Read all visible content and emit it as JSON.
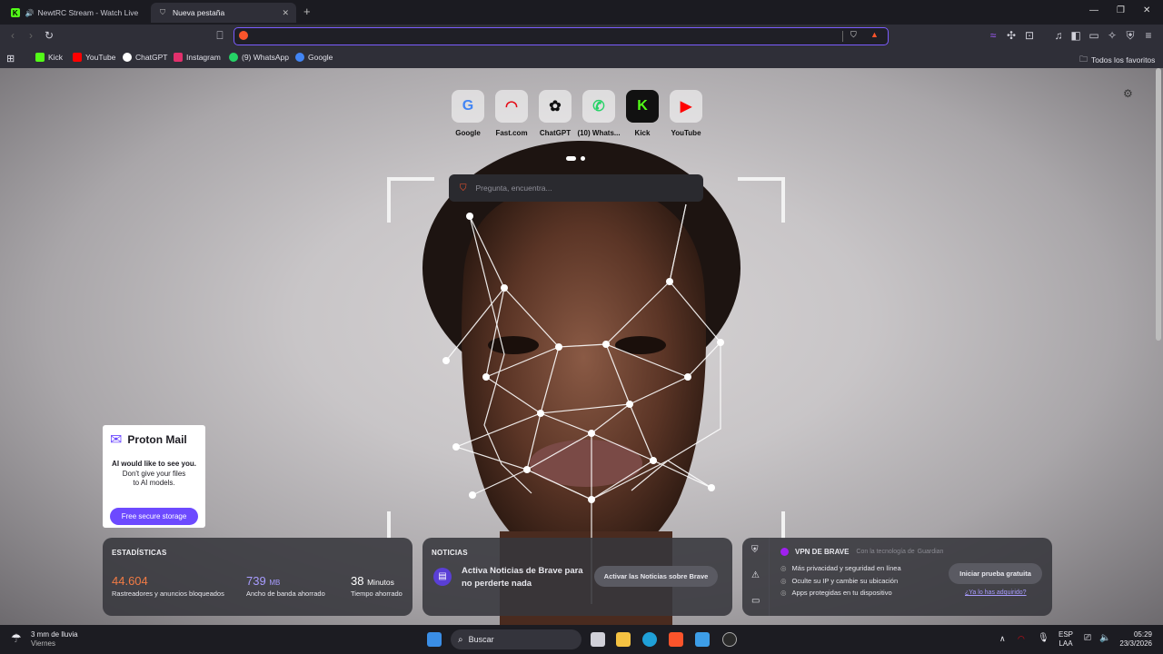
{
  "tabs": [
    {
      "title": "NewtRC Stream - Watch Live on K",
      "active": false
    },
    {
      "title": "Nueva pestaña",
      "active": true
    }
  ],
  "new_tab_symbol": "+",
  "window_controls": {
    "minimize": "—",
    "restore": "❐",
    "close": "✕"
  },
  "bookmarks": [
    {
      "label": "Kick",
      "icon": "kick-icon",
      "color": "#53fc18"
    },
    {
      "label": "YouTube",
      "icon": "youtube-icon",
      "color": "#ff0000"
    },
    {
      "label": "ChatGPT",
      "icon": "chatgpt-icon",
      "color": "#ffffff"
    },
    {
      "label": "Instagram",
      "icon": "instagram-icon",
      "color": "#e1306c"
    },
    {
      "label": "(9) WhatsApp",
      "icon": "whatsapp-icon",
      "color": "#25d366"
    },
    {
      "label": "Google",
      "icon": "google-icon",
      "color": "#4285f4"
    }
  ],
  "bookmarks_all": "Todos los favoritos",
  "shortcuts": [
    {
      "label": "Google",
      "glyph": "G",
      "color": "#4285f4"
    },
    {
      "label": "Fast.com",
      "glyph": "◠",
      "color": "#e50914"
    },
    {
      "label": "ChatGPT",
      "glyph": "✿",
      "color": "#111111"
    },
    {
      "label": "(10) Whats...",
      "glyph": "✆",
      "color": "#25d366"
    },
    {
      "label": "Kick",
      "glyph": "K",
      "color": "#53fc18"
    },
    {
      "label": "YouTube",
      "glyph": "▶",
      "color": "#ff0000"
    }
  ],
  "search": {
    "placeholder": "Pregunta, encuentra..."
  },
  "proton": {
    "brand": "Proton Mail",
    "line1": "AI would like to see you.",
    "line2": "Don't give your files",
    "line3": "to AI models.",
    "cta": "Free secure storage"
  },
  "stats": {
    "title": "ESTADÍSTICAS",
    "blocked_value": "44.604",
    "blocked_label": "Rastreadores y anuncios bloqueados",
    "bandwidth_value": "739",
    "bandwidth_unit": "MB",
    "bandwidth_label": "Ancho de banda ahorrado",
    "time_value": "38",
    "time_unit": "Minutos",
    "time_label": "Tiempo ahorrado"
  },
  "news": {
    "title": "NOTICIAS",
    "text1": "Activa Noticias de Brave para",
    "text2": "no perderte nada",
    "button": "Activar las Noticias sobre Brave"
  },
  "vpn": {
    "title": "VPN DE BRAVE",
    "powered": "Con la tecnología de",
    "powered_brand": "Guardian",
    "features": [
      "Más privacidad y seguridad en línea",
      "Oculte su IP y cambie su ubicación",
      "Apps protegidas en tu dispositivo"
    ],
    "button": "Iniciar prueba gratuita",
    "link": "¿Ya lo has adquirido?"
  },
  "taskbar": {
    "weather_line1": "3 mm de lluvia",
    "weather_line2": "Viernes",
    "search_label": "Buscar",
    "lang1": "ESP",
    "lang2": "LAA",
    "time": "05:29",
    "date": "23/3/2026"
  },
  "colors": {
    "accent": "#7b5cff",
    "brave_orange": "#fb542b",
    "stats_orange": "#f27b45",
    "stats_purple": "#a89cff",
    "proton_purple": "#6d4aff"
  }
}
